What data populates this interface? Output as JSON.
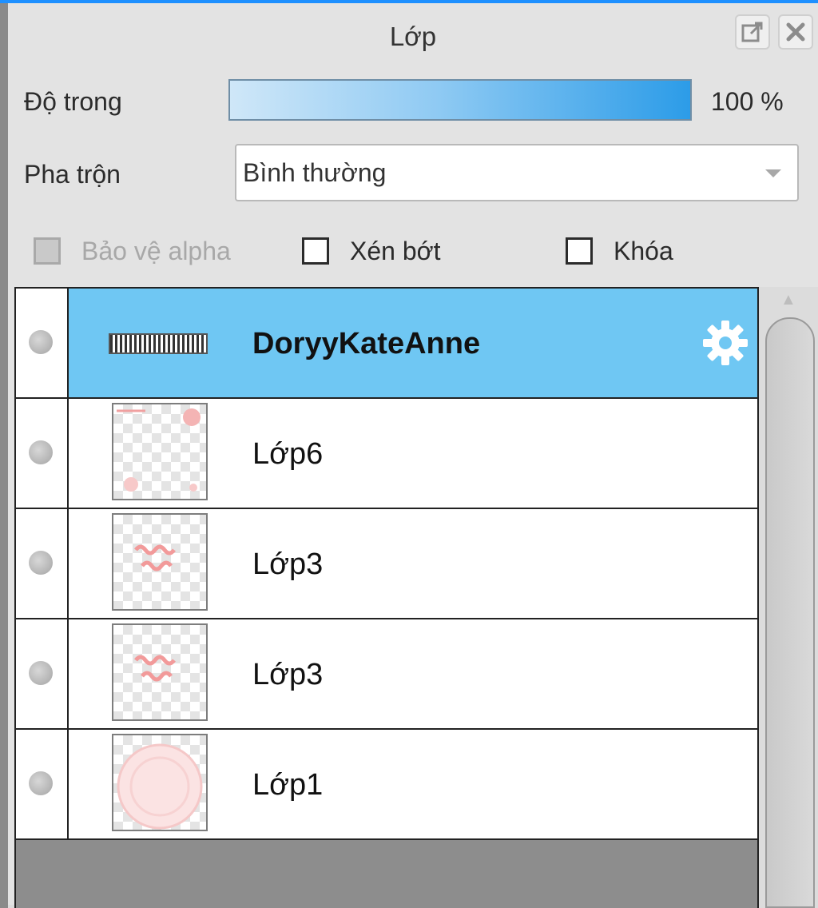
{
  "panel": {
    "title": "Lớp",
    "accent_color": "#1e90ff",
    "selected_color": "#6fc7f3"
  },
  "opacity": {
    "label": "Độ trong",
    "value_text": "100 %",
    "fraction": 1.0
  },
  "blend": {
    "label": "Pha trộn",
    "selected": "Bình thường"
  },
  "options": {
    "protect_alpha": {
      "label": "Bảo vệ alpha",
      "checked": false,
      "enabled": false
    },
    "clipping": {
      "label": "Xén bớt",
      "checked": false,
      "enabled": true
    },
    "lock": {
      "label": "Khóa",
      "checked": false,
      "enabled": true
    }
  },
  "layers": [
    {
      "name": "DoryyKateAnne",
      "selected": true,
      "thumb": "text-banner"
    },
    {
      "name": "Lớp6",
      "selected": false,
      "thumb": "pink-dots"
    },
    {
      "name": "Lớp3",
      "selected": false,
      "thumb": "pink-text"
    },
    {
      "name": "Lớp3",
      "selected": false,
      "thumb": "pink-text"
    },
    {
      "name": "Lớp1",
      "selected": false,
      "thumb": "pink-circle"
    }
  ],
  "icons": {
    "detach": "external-window-icon",
    "close": "close-icon",
    "settings": "gear-icon",
    "visibility": "visibility-dot-icon"
  }
}
